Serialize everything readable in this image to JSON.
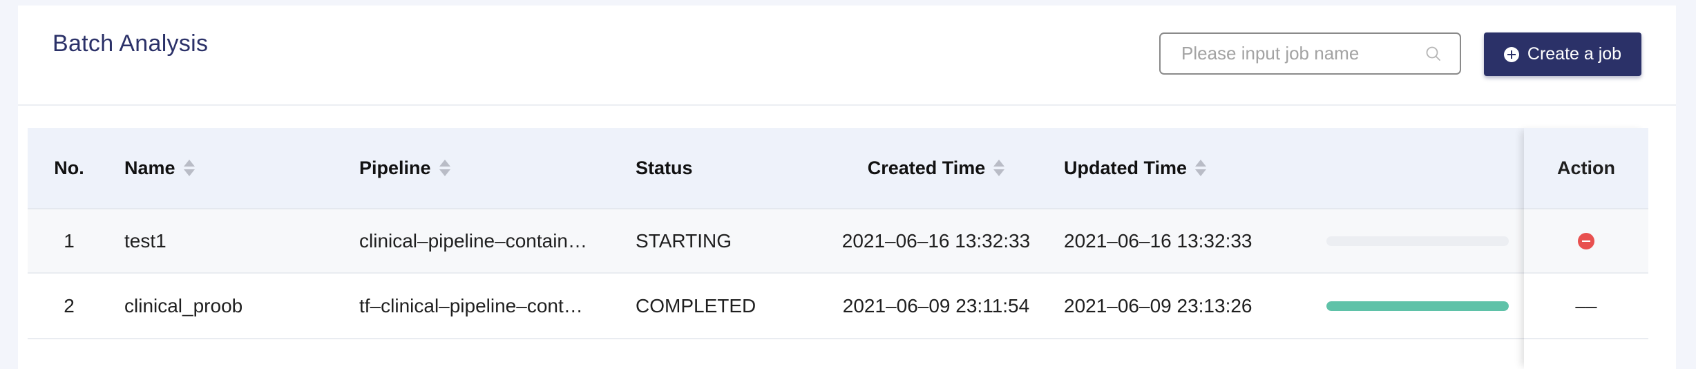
{
  "header": {
    "title": "Batch Analysis",
    "search_placeholder": "Please input job name",
    "create_button_label": "Create a job"
  },
  "table": {
    "columns": {
      "no": "No.",
      "name": "Name",
      "pipeline": "Pipeline",
      "status": "Status",
      "created": "Created Time",
      "updated": "Updated Time",
      "action": "Action"
    },
    "rows": [
      {
        "no": "1",
        "name": "test1",
        "pipeline": "clinical–pipeline–contain…",
        "status": "STARTING",
        "created": "2021–06–16 13:32:33",
        "updated": "2021–06–16 13:32:33",
        "progress": 0,
        "action": "stop-icon"
      },
      {
        "no": "2",
        "name": "clinical_proob",
        "pipeline": "tf–clinical–pipeline–cont…",
        "status": "COMPLETED",
        "created": "2021–06–09 23:11:54",
        "updated": "2021–06–09 23:13:26",
        "progress": 100,
        "action": "––"
      }
    ]
  },
  "colors": {
    "brand": "#2b3168",
    "progress_fill": "#5fc2a8",
    "stop_icon": "#e8504f",
    "header_bg": "#eef2fa"
  }
}
